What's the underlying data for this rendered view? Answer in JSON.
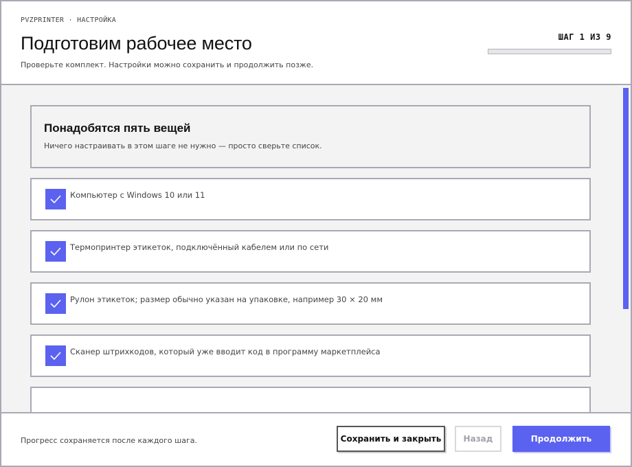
{
  "header": {
    "breadcrumb": "PVZPRINTER · НАСТРОЙКА",
    "title": "Подготовим рабочее место",
    "subtitle": "Проверьте комплект. Настройки можно сохранить и продолжить позже.",
    "step_label": "ШАГ 1 ИЗ 9",
    "step_current": 1,
    "step_total": 9,
    "progress_fraction": 0.0
  },
  "intro": {
    "title": "Понадобятся пять вещей",
    "text": "Ничего настраивать в этом шаге не нужно — просто сверьте список."
  },
  "checklist": [
    {
      "label": "Компьютер с Windows 10 или 11",
      "checked": true
    },
    {
      "label": "Термопринтер этикеток, подключённый кабелем или по сети",
      "checked": true
    },
    {
      "label": "Рулон этикеток; размер обычно указан на упаковке, например 30 × 20 мм",
      "checked": true
    },
    {
      "label": "Сканер штрихкодов, который уже вводит код в программу маркетплейса",
      "checked": true
    }
  ],
  "footer": {
    "note": "Прогресс сохраняется после каждого шага.",
    "save_label": "Сохранить и закрыть",
    "back_label": "Назад",
    "next_label": "Продолжить"
  },
  "colors": {
    "accent": "#5b62f0",
    "border": "#a9a9b3",
    "panel_bg": "#f3f3f4"
  },
  "icons": {
    "checkbox": "check-icon"
  }
}
